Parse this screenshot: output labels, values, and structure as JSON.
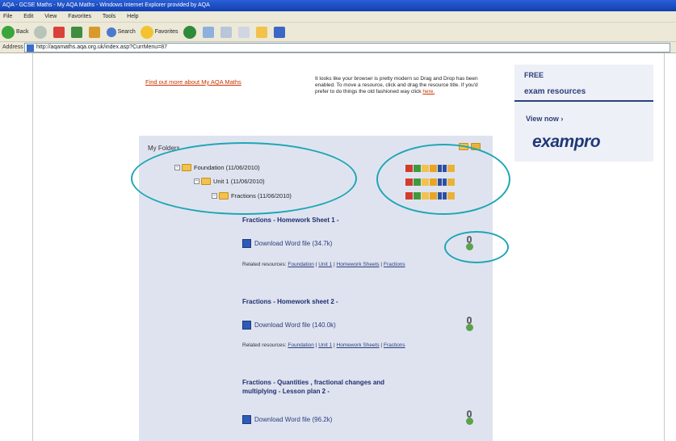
{
  "browser": {
    "title": "AQA - GCSE Maths - My AQA Maths - Windows Internet Explorer provided by AQA",
    "menu": [
      "File",
      "Edit",
      "View",
      "Favorites",
      "Tools",
      "Help"
    ],
    "toolbar": {
      "back": "Back",
      "search": "Search",
      "favorites": "Favorites"
    },
    "address_label": "Address",
    "address": "http://aqamaths.aqa.org.uk/index.asp?CurrMenu=87"
  },
  "page": {
    "find_out_link": "Find out more about My AQA Maths",
    "notice_text": "It looks like your browser is pretty modern so Drag and Drop has been enabled. To move a resource, click and drag the resource title. If you'd prefer to do things the old fashioned way click",
    "notice_link": "here.",
    "ad": {
      "free": "FREE",
      "title": "exam resources",
      "view_now": "View now ›",
      "logo": "exampro"
    }
  },
  "folders": {
    "title": "My Folders",
    "tree": [
      {
        "label": "Foundation",
        "date": "(11/06/2010)"
      },
      {
        "label": "Unit 1",
        "date": "(11/06/2010)"
      },
      {
        "label": "Fractions",
        "date": "(11/06/2010)"
      }
    ],
    "resources": [
      {
        "title": "Fractions - Homework Sheet 1 -",
        "download": "Download Word file",
        "size": "(34.7k)",
        "related_label": "Related resources:",
        "related": [
          "Foundation",
          "Unit 1",
          "Homework Sheets",
          "Fractions"
        ]
      },
      {
        "title": "Fractions - Homework sheet 2 -",
        "download": "Download Word file",
        "size": "(140.0k)",
        "related_label": "Related resources:",
        "related": [
          "Foundation",
          "Unit 1",
          "Homework Sheets",
          "Fractions"
        ]
      },
      {
        "title": "Fractions - Quantities , fractional changes and multiplying - Lesson plan 2 -",
        "download": "Download Word file",
        "size": "(96.2k)"
      }
    ]
  },
  "colors": {
    "highlight": "#1fa6b4",
    "panel": "#dfe3f0",
    "link_orange": "#cc3300",
    "navy": "#1f2f6d"
  }
}
